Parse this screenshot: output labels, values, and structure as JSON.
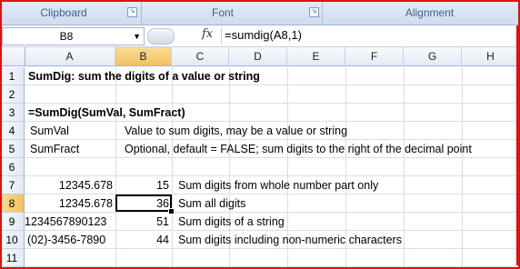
{
  "ribbon": {
    "groups": [
      "Clipboard",
      "Font",
      "Alignment"
    ]
  },
  "formula_bar": {
    "name_box": "B8",
    "fx_label": "fx",
    "formula": "=sumdig(A8,1)"
  },
  "sheet": {
    "columns": [
      "A",
      "B",
      "C",
      "D",
      "E",
      "F",
      "G",
      "H"
    ],
    "selected_column": "B",
    "selected_row": "8",
    "rows": [
      "1",
      "2",
      "3",
      "4",
      "5",
      "6",
      "7",
      "8",
      "9",
      "10",
      "11"
    ],
    "cells": {
      "r1a": "SumDig:  sum the digits of a value or string",
      "r3a": "=SumDig(SumVal, SumFract)",
      "r4a": "SumVal",
      "r4c": "Value to sum digits, may be a value or string",
      "r5a": "SumFract",
      "r5c": "Optional, default = FALSE; sum digits to the right of the decimal point",
      "r7a": "12345.678",
      "r7b": "15",
      "r7c": "Sum digits from whole number part only",
      "r8a": "12345.678",
      "r8b": "36",
      "r8c": "Sum all digits",
      "r9a": "1234567890123",
      "r9b": "51",
      "r9c": "Sum digits of a string",
      "r10a": "(02)-3456-7890",
      "r10b": "44",
      "r10c": "Sum digits including non-numeric characters"
    }
  }
}
